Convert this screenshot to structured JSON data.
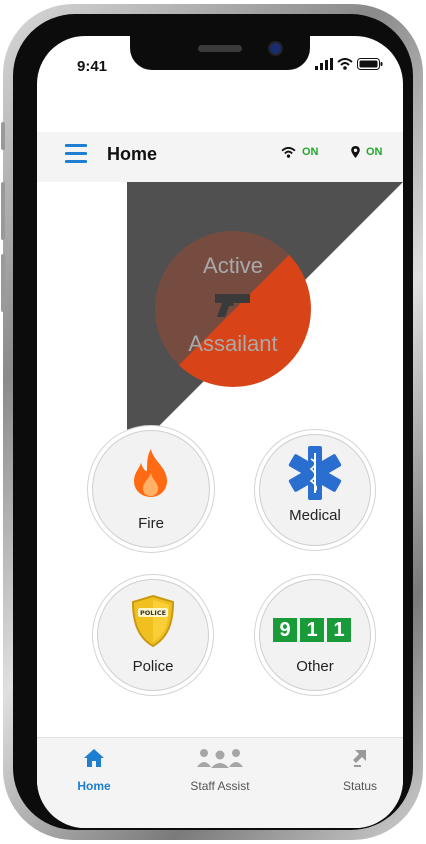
{
  "status_bar": {
    "time": "9:41"
  },
  "header": {
    "title": "Home",
    "wifi_status": "ON",
    "location_status": "ON",
    "accent_color": "#1e7fd0",
    "status_color": "#22a92f"
  },
  "emergency": {
    "active_assailant": {
      "line1": "Active",
      "line2": "Assailant",
      "icon": "pistol-icon"
    },
    "buttons": [
      {
        "label": "Fire",
        "icon": "flame-icon"
      },
      {
        "label": "Medical",
        "icon": "star-of-life-icon"
      },
      {
        "label": "Police",
        "icon": "police-badge-icon"
      },
      {
        "label": "Other",
        "icon": "911-icon",
        "digits": [
          "9",
          "1",
          "1"
        ]
      }
    ]
  },
  "tabs": [
    {
      "label": "Home",
      "icon": "home-icon",
      "active": true
    },
    {
      "label": "Staff Assist",
      "icon": "staff-group-icon",
      "active": false
    },
    {
      "label": "Status",
      "icon": "status-arrows-icon",
      "active": false
    }
  ]
}
